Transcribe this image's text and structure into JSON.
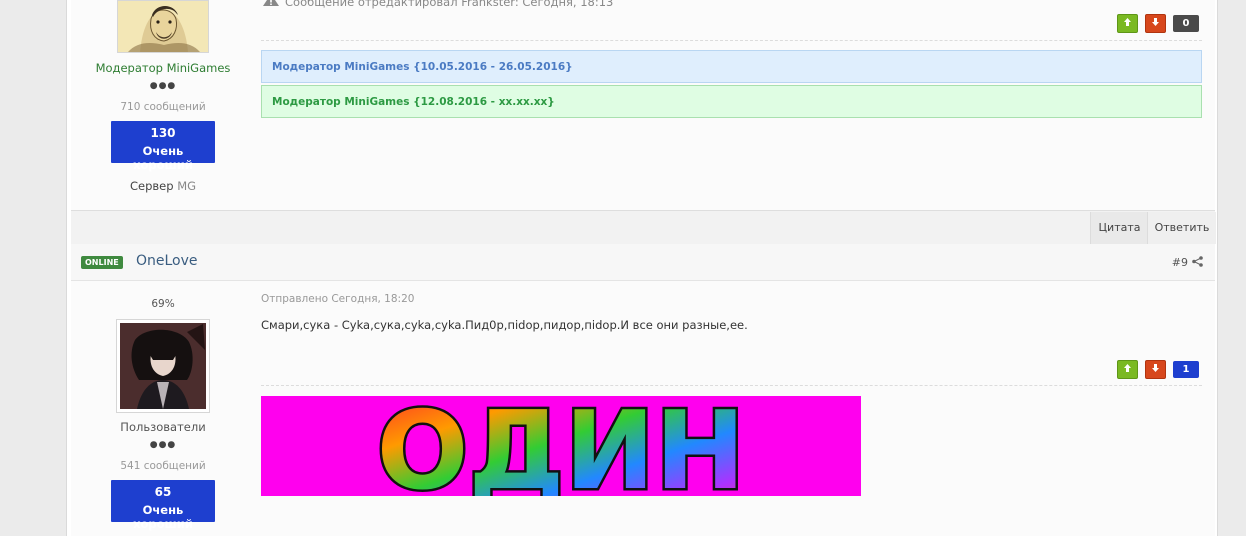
{
  "post1": {
    "group_title": "Модератор MiniGames",
    "pips": "●●●",
    "post_count": "710 сообщений",
    "reputation": {
      "value": "130",
      "label": "Очень хороший"
    },
    "server_label": "Сервер",
    "server_value": "MG",
    "edited_text": "Сообщение отредактировал Frankster: Сегодня, 18:13",
    "vote_count": "0",
    "notices": [
      "Модератор MiniGames {10.05.2016 - 26.05.2016}",
      "Модератор MiniGames {12.08.2016 - xx.xx.xx}"
    ]
  },
  "actions": {
    "quote": "Цитата",
    "reply": "Ответить"
  },
  "post2": {
    "online_badge": "ONLINE",
    "author": "OneLove",
    "post_number": "#9",
    "rank_percent": "69%",
    "group_title": "Пользователи",
    "pips": "●●●",
    "post_count": "541 сообщений",
    "reputation": {
      "value": "65",
      "label": "Очень хороший"
    },
    "posted_on": "Отправлено Сегодня, 18:20",
    "body": "Смари,сука - Cyka,сука,cyka,cyka.Пид0р,пidор,пидор,пidор.И все они разные,ее.",
    "vote_count": "1",
    "banner_text": "ОДИН"
  },
  "colors": {
    "rep_blue": "#1e3fcf",
    "vote_up": "#7ab922",
    "vote_down": "#d7471c",
    "online_green": "#3f8a3f",
    "moderator_green": "#2e7d32",
    "banner_magenta": "#ff00ee"
  },
  "icons": [
    "warning-icon",
    "arrow-up-icon",
    "arrow-down-icon",
    "share-icon"
  ]
}
